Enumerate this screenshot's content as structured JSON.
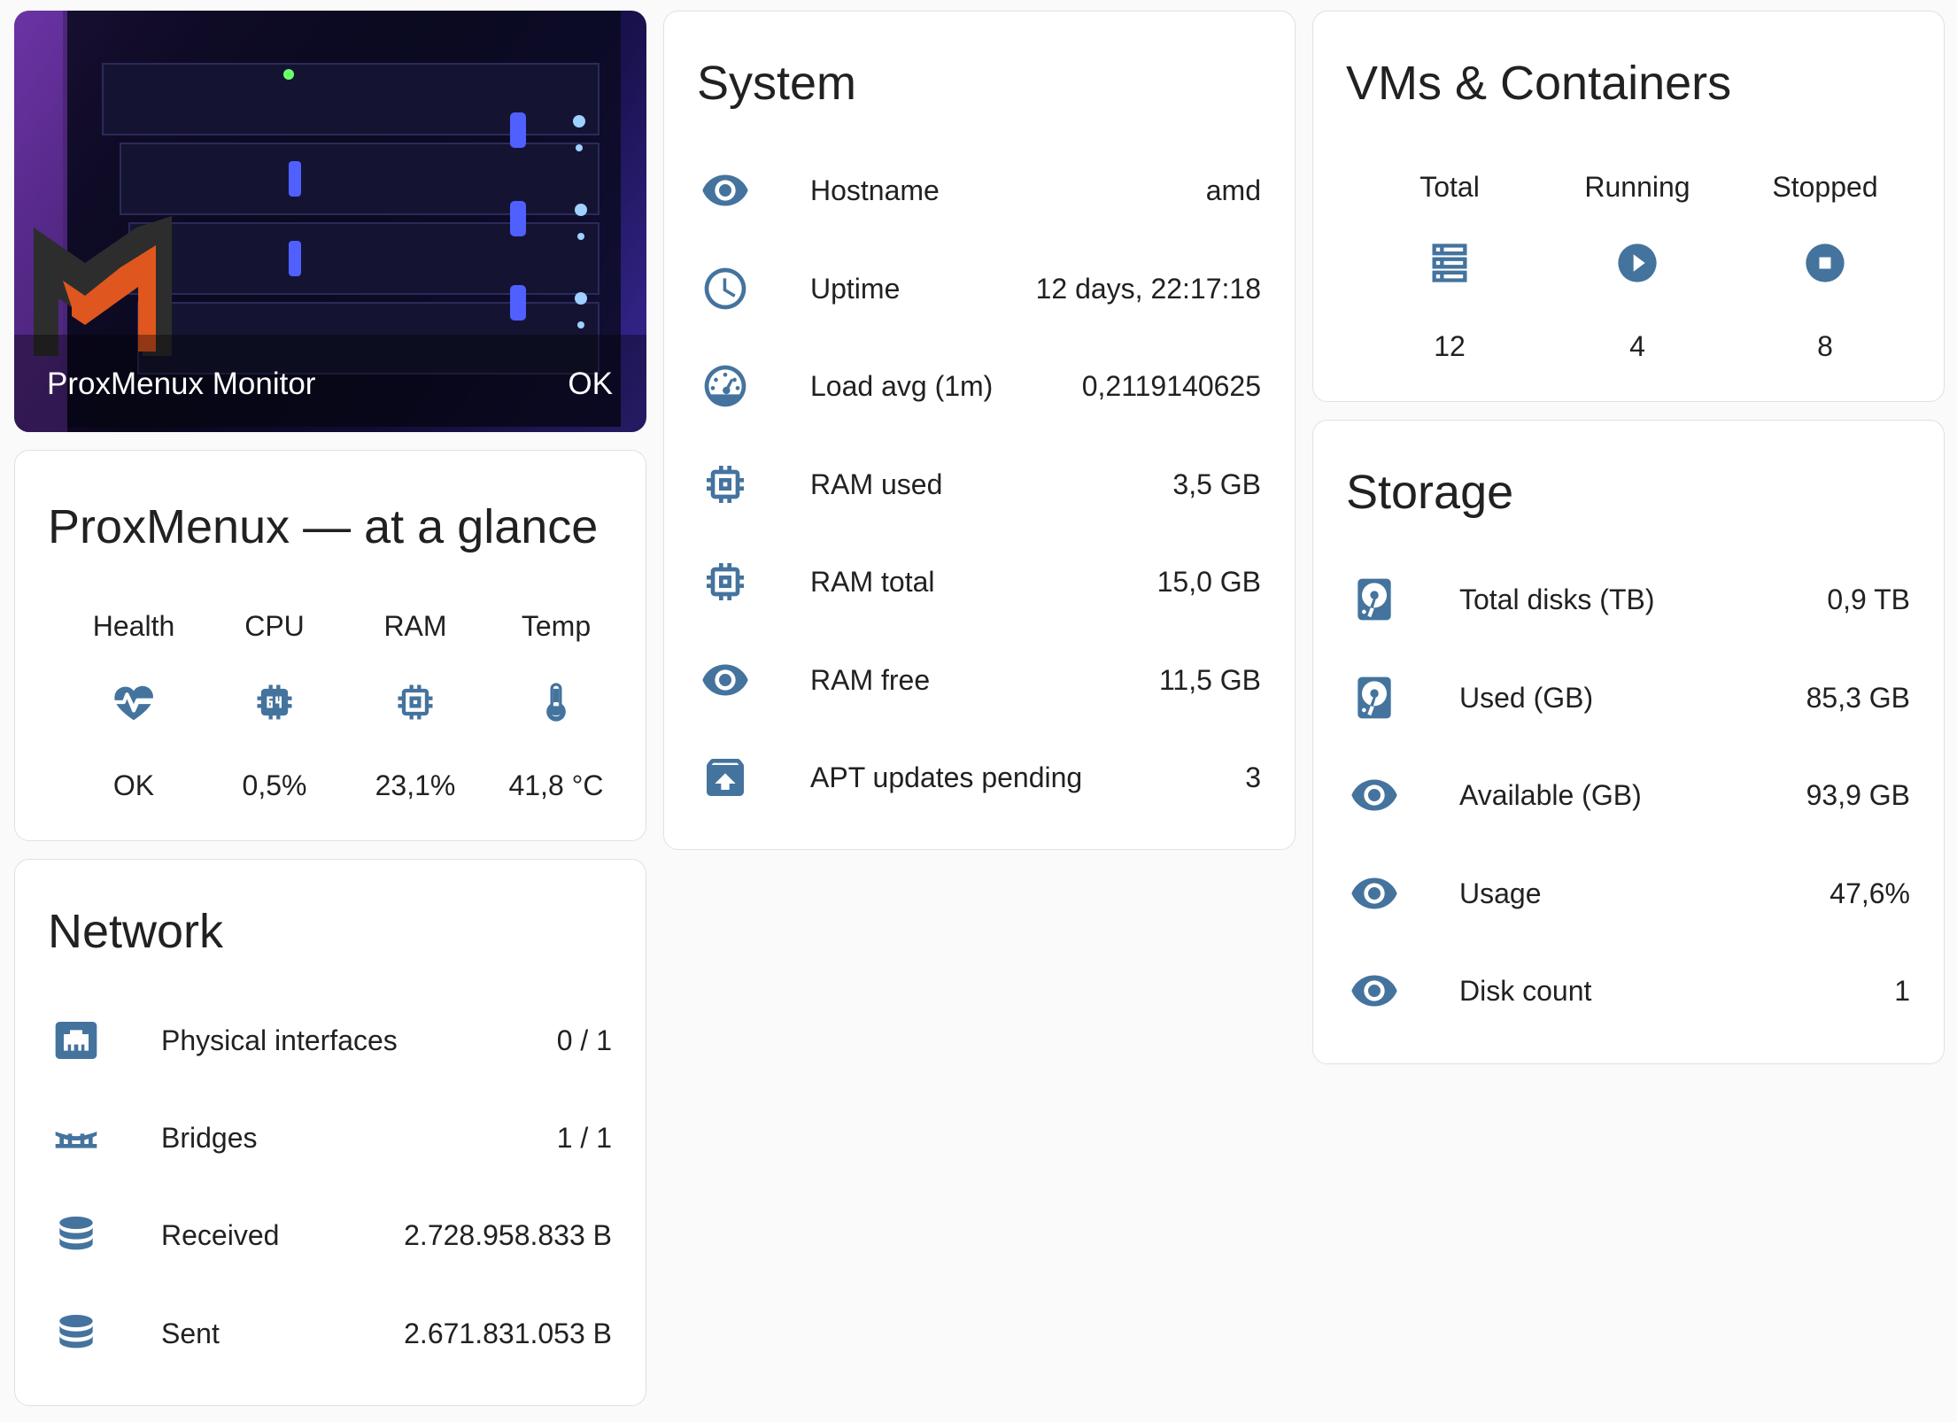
{
  "picture_card": {
    "name": "ProxMenux Monitor",
    "state": "OK"
  },
  "glance": {
    "title": "ProxMenux — at a glance",
    "items": [
      {
        "label": "Health",
        "icon": "heart-pulse-icon",
        "value": "OK"
      },
      {
        "label": "CPU",
        "icon": "cpu-64-icon",
        "value": "0,5%"
      },
      {
        "label": "RAM",
        "icon": "memory-chip-icon",
        "value": "23,1%"
      },
      {
        "label": "Temp",
        "icon": "thermometer-icon",
        "value": "41,8 °C"
      }
    ]
  },
  "network": {
    "title": "Network",
    "rows": [
      {
        "icon": "ethernet-icon",
        "label": "Physical interfaces",
        "value": "0 / 1"
      },
      {
        "icon": "bridge-icon",
        "label": "Bridges",
        "value": "1 / 1"
      },
      {
        "icon": "database-icon",
        "label": "Received",
        "value": "2.728.958.833 B"
      },
      {
        "icon": "database-icon",
        "label": "Sent",
        "value": "2.671.831.053 B"
      }
    ]
  },
  "system": {
    "title": "System",
    "rows": [
      {
        "icon": "eye-icon",
        "label": "Hostname",
        "value": "amd"
      },
      {
        "icon": "clock-icon",
        "label": "Uptime",
        "value": "12 days, 22:17:18"
      },
      {
        "icon": "gauge-icon",
        "label": "Load avg (1m)",
        "value": "0,2119140625"
      },
      {
        "icon": "memory-chip-icon",
        "label": "RAM used",
        "value": "3,5 GB"
      },
      {
        "icon": "memory-chip-icon",
        "label": "RAM total",
        "value": "15,0 GB"
      },
      {
        "icon": "eye-icon",
        "label": "RAM free",
        "value": "11,5 GB"
      },
      {
        "icon": "package-up-icon",
        "label": "APT updates pending",
        "value": "3"
      }
    ]
  },
  "vms": {
    "title": "VMs & Containers",
    "items": [
      {
        "label": "Total",
        "icon": "server-icon",
        "value": "12"
      },
      {
        "label": "Running",
        "icon": "play-circle-icon",
        "value": "4"
      },
      {
        "label": "Stopped",
        "icon": "stop-circle-icon",
        "value": "8"
      }
    ]
  },
  "storage": {
    "title": "Storage",
    "rows": [
      {
        "icon": "harddisk-icon",
        "label": "Total disks (TB)",
        "value": "0,9 TB"
      },
      {
        "icon": "harddisk-icon",
        "label": "Used (GB)",
        "value": "85,3 GB"
      },
      {
        "icon": "eye-icon",
        "label": "Available (GB)",
        "value": "93,9 GB"
      },
      {
        "icon": "eye-icon",
        "label": "Usage",
        "value": "47,6%"
      },
      {
        "icon": "eye-icon",
        "label": "Disk count",
        "value": "1"
      }
    ]
  },
  "colors": {
    "icon": "#44739e",
    "card_bg": "#ffffff",
    "page_bg": "#fafafa",
    "logo_orange": "#e0561f"
  }
}
